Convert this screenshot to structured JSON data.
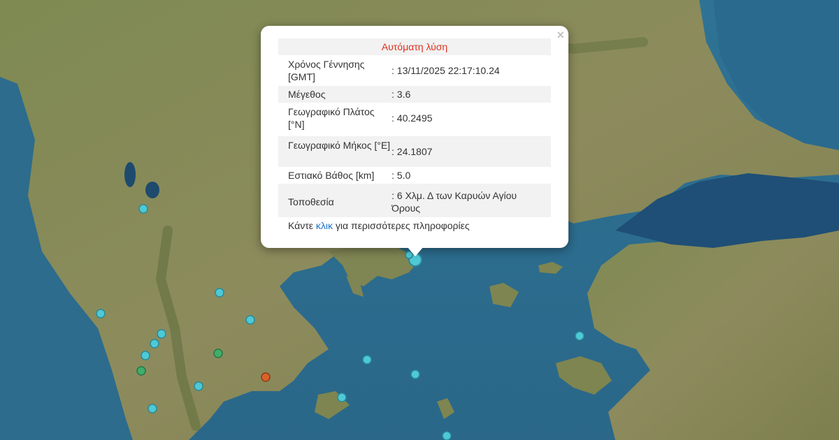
{
  "popup": {
    "title": "Αυτόματη λύση",
    "close_label": "×",
    "rows": [
      {
        "label": "Χρόνος Γέννησης [GMT]",
        "value": ": 13/11/2025 22:17:10.24"
      },
      {
        "label": "Μέγεθος",
        "value": ": 3.6"
      },
      {
        "label": "Γεωγραφικό Πλάτος [°N]",
        "value": ": 40.2495"
      },
      {
        "label": "Γεωγραφικό Μήκος [°E]",
        "value": ": 24.1807"
      },
      {
        "label": "Εστιακό Βάθος [km]",
        "value": ": 5.0"
      },
      {
        "label": "Τοποθεσία",
        "value": ": 6 Χλμ. Δ των Καρυών Αγίου Όρους"
      }
    ],
    "more_prefix": "Κάντε ",
    "more_link": "κλικ",
    "more_suffix": " για περισσότερες πληροφορίες"
  },
  "colors": {
    "sea": "#2e6f8e",
    "land": "#8c8d5a",
    "land_dark": "#5f7440",
    "marker_cyan": "#4ec9d6",
    "marker_green": "#3fae6a",
    "marker_orange": "#d9622b",
    "title_red": "#e0301e",
    "link_blue": "#1a73c9"
  }
}
